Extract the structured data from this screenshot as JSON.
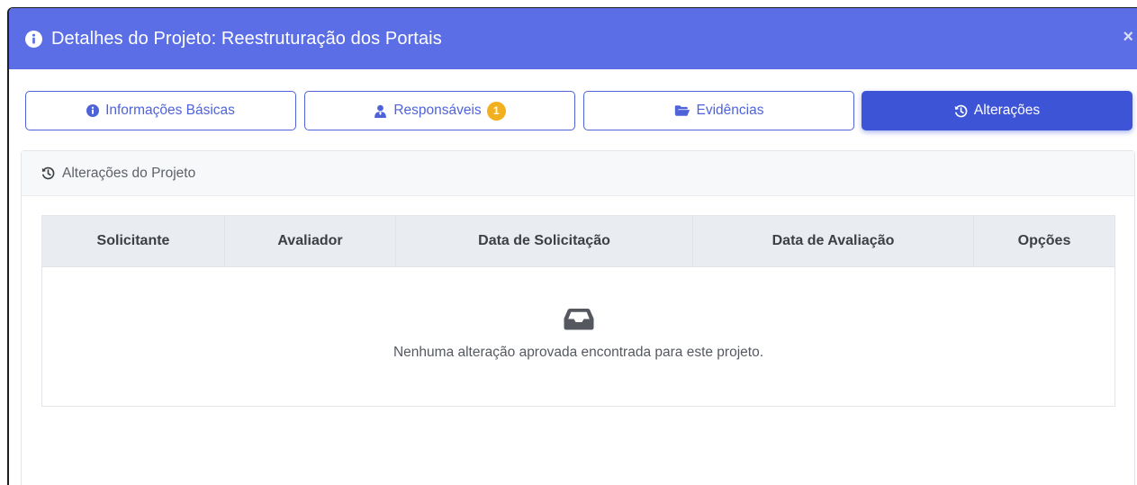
{
  "modal": {
    "title": "Detalhes do Projeto: Reestruturação dos Portais",
    "close_label": "×",
    "colors": {
      "header": "#5b6ee6",
      "accent": "#3d54d6",
      "badge": "#f2b01e"
    }
  },
  "tabs": [
    {
      "label": "Informações Básicas",
      "icon": "info-circle-icon",
      "active": false
    },
    {
      "label": "Responsáveis",
      "icon": "user-tie-icon",
      "badge": "1",
      "active": false
    },
    {
      "label": "Evidências",
      "icon": "folder-open-icon",
      "active": false
    },
    {
      "label": "Alterações",
      "icon": "history-icon",
      "active": true
    }
  ],
  "panel": {
    "title": "Alterações do Projeto",
    "icon": "history-icon"
  },
  "table": {
    "columns": [
      "Solicitante",
      "Avaliador",
      "Data de Solicitação",
      "Data de Avaliação",
      "Opções"
    ],
    "rows": [],
    "empty_icon": "inbox-icon",
    "empty_message": "Nenhuma alteração aprovada encontrada para este projeto."
  }
}
